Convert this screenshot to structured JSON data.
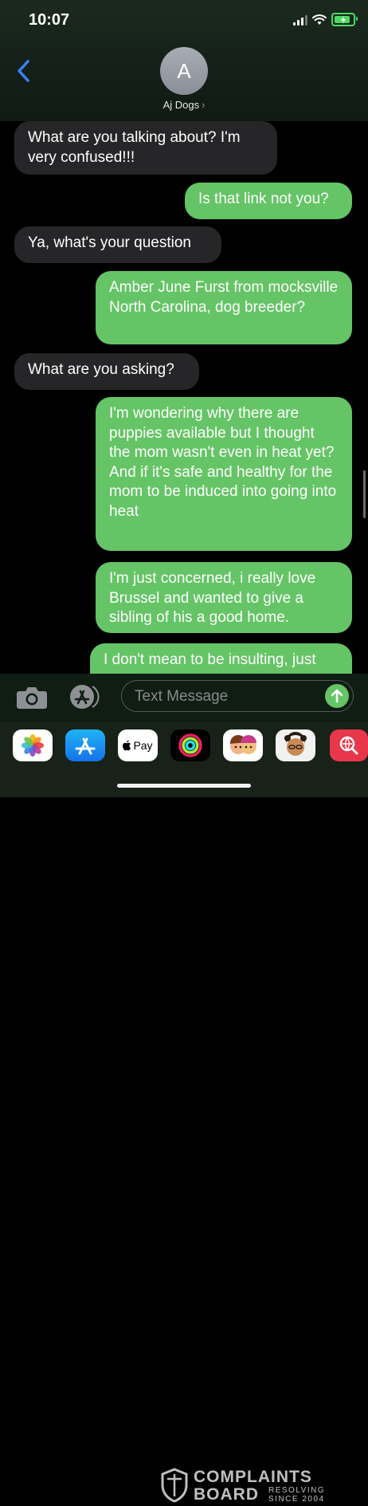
{
  "status_bar": {
    "time": "10:07"
  },
  "header": {
    "avatar_initial": "A",
    "contact_name": "Aj Dogs",
    "chevron": "›"
  },
  "messages": [
    {
      "direction": "incoming",
      "text": "What are you talking about? I'm very confused!!!"
    },
    {
      "direction": "outgoing",
      "text": "Is that link not you?"
    },
    {
      "direction": "incoming",
      "text": "Ya, what's your question"
    },
    {
      "direction": "outgoing",
      "text": "Amber June Furst from mocksville North Carolina, dog breeder?"
    },
    {
      "direction": "incoming",
      "text": "What are you asking?"
    },
    {
      "direction": "outgoing",
      "text": "I'm wondering why there are puppies available but I thought the mom wasn't even in heat yet? And if it's safe and healthy for the mom to be induced into going into heat"
    },
    {
      "direction": "outgoing",
      "text": "I'm just concerned, i really love Brussel and wanted to give a sibling of his a good home."
    },
    {
      "direction": "outgoing",
      "text": "I don't mean to be insulting, just"
    }
  ],
  "input_bar": {
    "placeholder": "Text Message",
    "camera_icon": "camera-icon",
    "apps_icon": "app-store-icon",
    "send_icon": "arrow-up-icon"
  },
  "app_drawer": {
    "apps": [
      {
        "name": "photos",
        "icon": "photos-icon"
      },
      {
        "name": "app-store",
        "icon": "app-store-icon"
      },
      {
        "name": "apple-pay",
        "label": "Pay",
        "icon": "apple-pay-icon"
      },
      {
        "name": "fitness",
        "icon": "activity-rings-icon"
      },
      {
        "name": "memoji",
        "icon": "memoji-icon"
      },
      {
        "name": "memoji-2",
        "icon": "memoji-icon"
      },
      {
        "name": "search-images",
        "icon": "globe-search-icon"
      }
    ]
  },
  "watermark": {
    "line1": "COMPLAINTS",
    "line2": "BOARD",
    "tag1": "RESOLVING",
    "tag2": "SINCE 2004"
  },
  "colors": {
    "incoming_bubble": "#262628",
    "outgoing_bubble": "#65c466",
    "accent_blue": "#3b82f6",
    "send_green": "#65c466"
  }
}
